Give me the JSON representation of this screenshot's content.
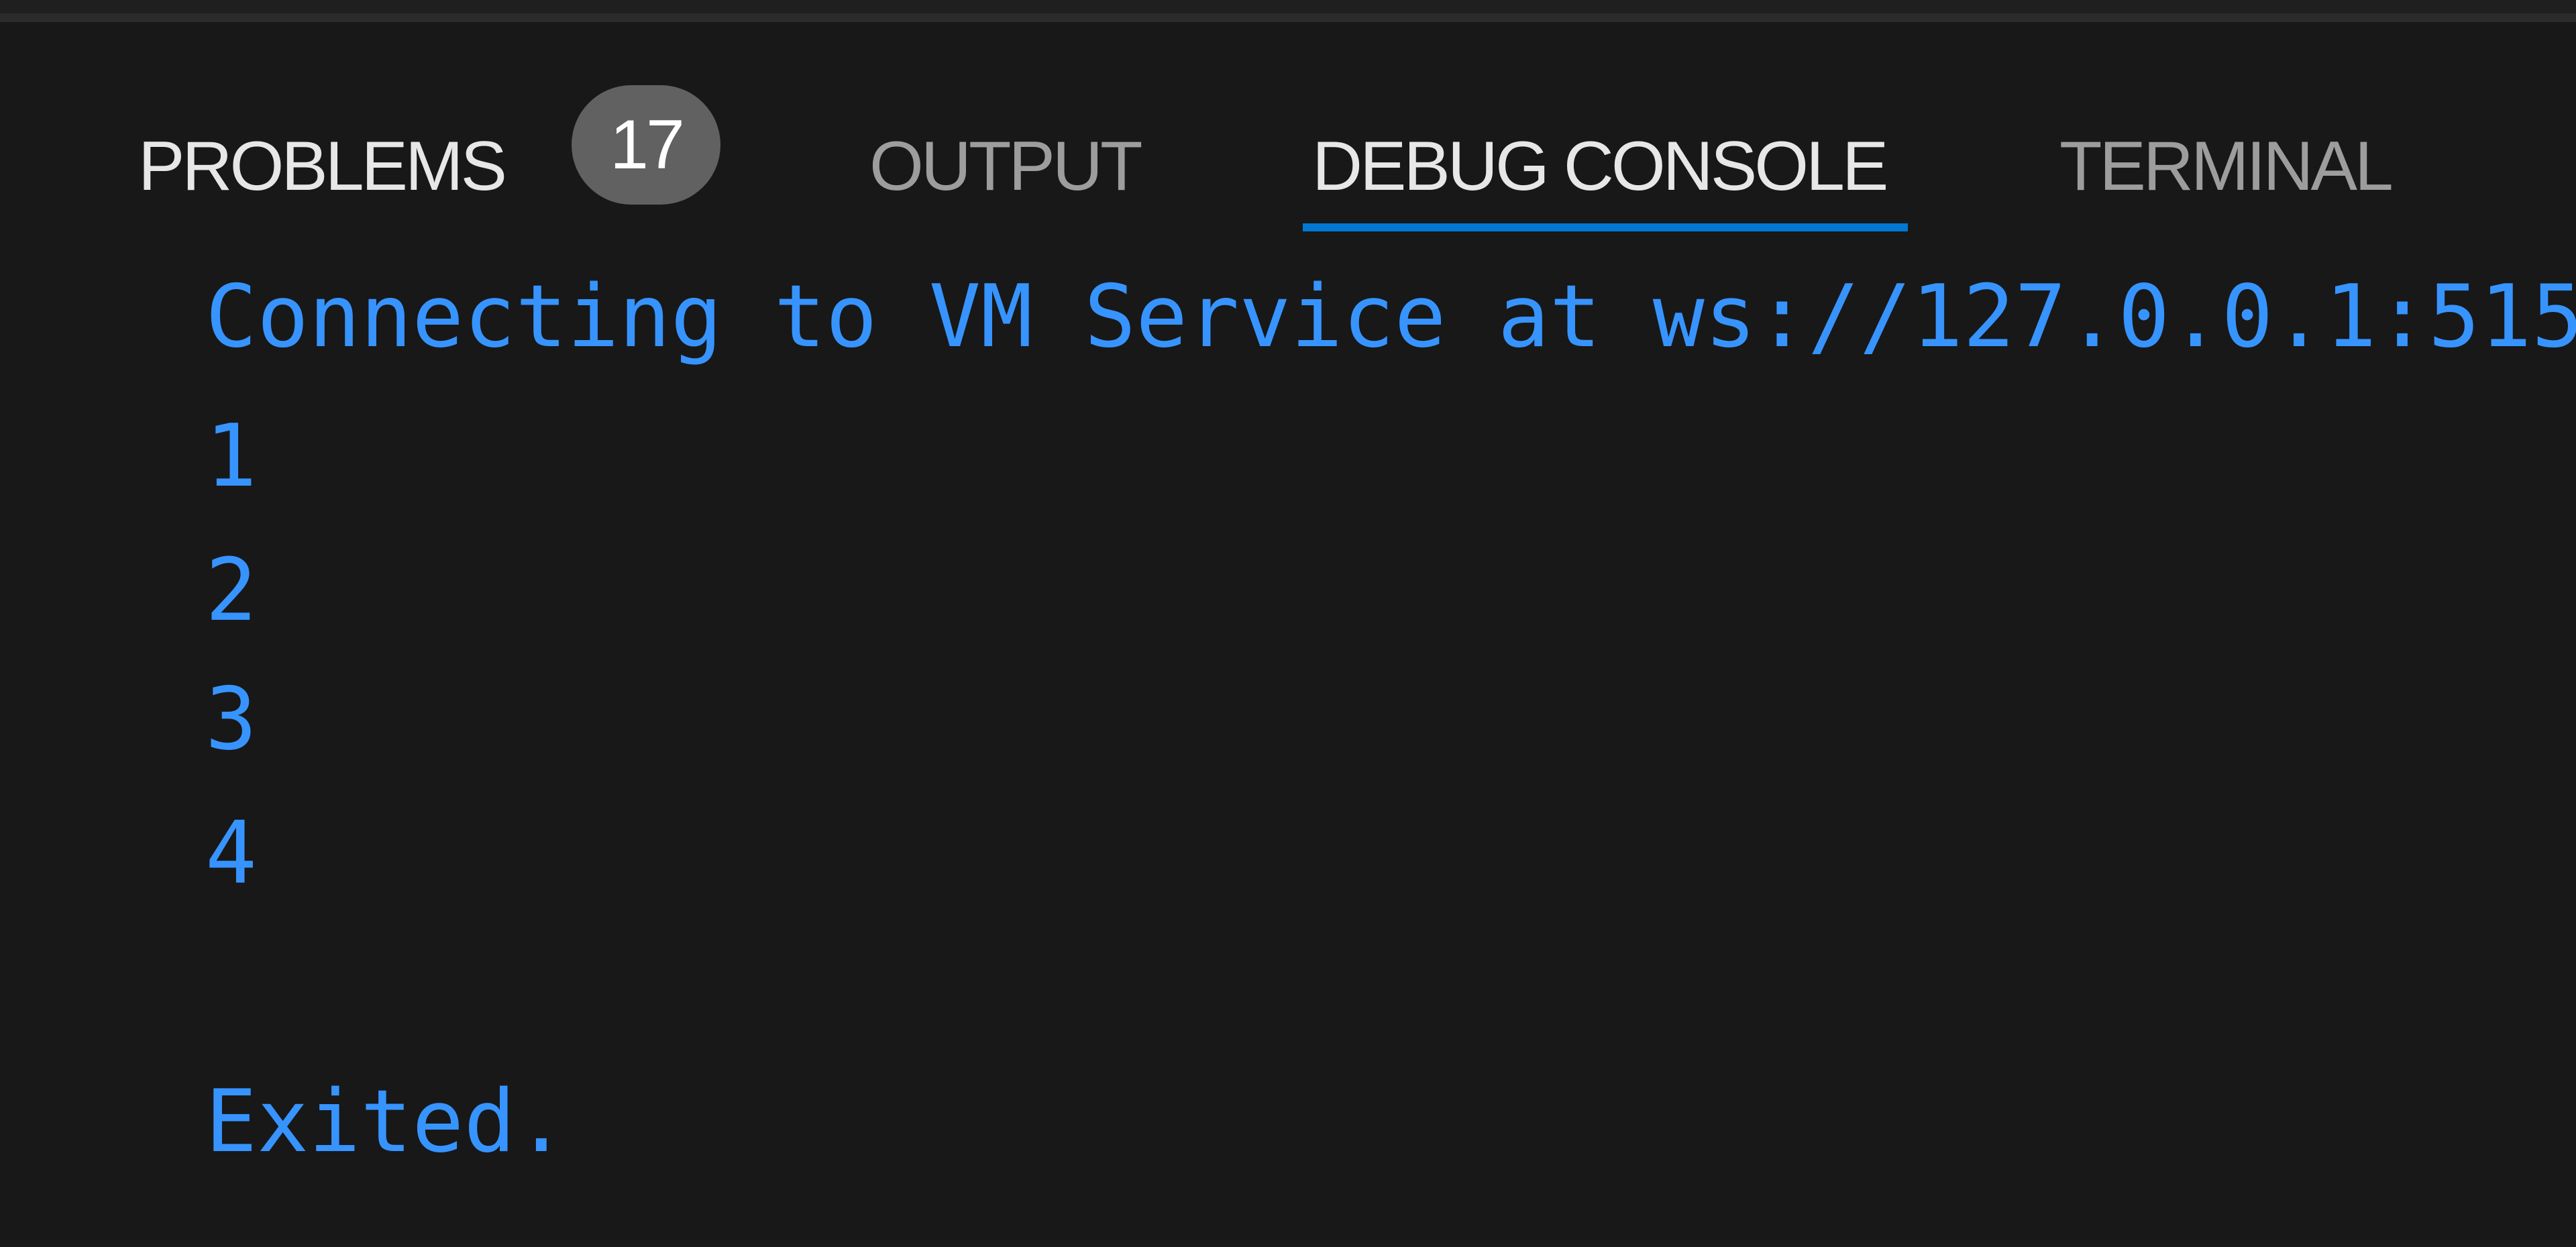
{
  "panel": {
    "tabs": [
      {
        "label": "PROBLEMS",
        "badge": "17",
        "active": false
      },
      {
        "label": "OUTPUT",
        "active": false
      },
      {
        "label": "DEBUG CONSOLE",
        "active": true
      },
      {
        "label": "TERMINAL",
        "active": false
      }
    ],
    "colors": {
      "background": "#181818",
      "accent": "#0078d4",
      "console_text": "#3794ff",
      "badge_bg": "#616161"
    }
  },
  "console": {
    "lines": [
      "Connecting to VM Service at ws://127.0.0.1:515",
      "1",
      "2",
      "3",
      "4",
      "Exited."
    ]
  }
}
